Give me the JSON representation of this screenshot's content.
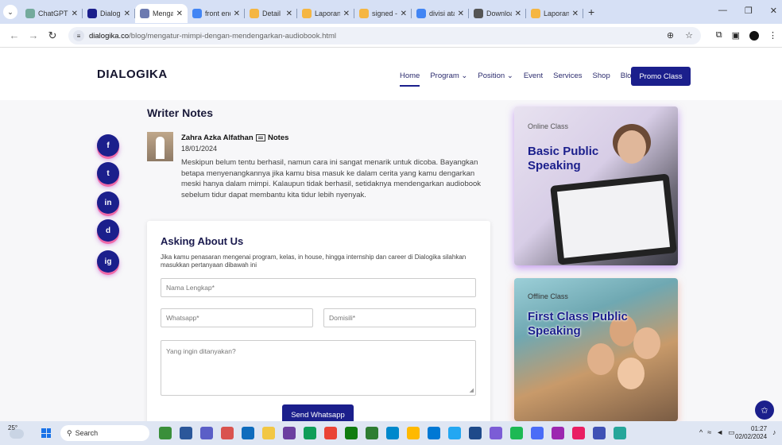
{
  "browser": {
    "tabs": [
      {
        "title": "ChatGPT",
        "color": "#74aa9c",
        "active": false
      },
      {
        "title": "Dialogika",
        "color": "#1b1f8c",
        "active": false
      },
      {
        "title": "Mengatur",
        "color": "#6c7ab0",
        "active": true
      },
      {
        "title": "front end",
        "color": "#4285f4",
        "active": false
      },
      {
        "title": "Detail",
        "color": "#f5b642",
        "active": false
      },
      {
        "title": "Laporan P",
        "color": "#f5b642",
        "active": false
      },
      {
        "title": "signed - R",
        "color": "#f5b642",
        "active": false
      },
      {
        "title": "divisi atau",
        "color": "#4285f4",
        "active": false
      },
      {
        "title": "Download",
        "color": "#555555",
        "active": false
      },
      {
        "title": "Laporan P",
        "color": "#f5b642",
        "active": false
      }
    ],
    "new_tab": "+",
    "url_host": "dialogika.co",
    "url_path": "/blog/mengatur-mimpi-dengan-mendengarkan-audiobook.html"
  },
  "site": {
    "logo": "DIALOGIKA",
    "nav": {
      "home": "Home",
      "program": "Program",
      "position": "Position",
      "event": "Event",
      "services": "Services",
      "shop": "Shop",
      "blog": "Blog"
    },
    "promo_button": "Promo Class"
  },
  "social": [
    "f",
    "t",
    "in",
    "d",
    "ig"
  ],
  "article": {
    "section_title": "Writer Notes",
    "author": "Zahra Azka Alfathan",
    "category": "Notes",
    "date": "18/01/2024",
    "body": "Meskipun belum tentu berhasil, namun cara ini sangat menarik untuk dicoba. Bayangkan betapa menyenangkannya jika kamu bisa masuk ke dalam cerita yang kamu dengarkan meski hanya dalam mimpi. Kalaupun tidak berhasil, setidaknya mendengarkan audiobook sebelum tidur dapat membantu kita tidur lebih nyenyak."
  },
  "form": {
    "title": "Asking About Us",
    "description": "Jika kamu penasaran mengenai program, kelas, in house, hingga internship dan career di Dialogika silahkan masukkan pertanyaan dibawah ini",
    "name_placeholder": "Nama Lengkap*",
    "whatsapp_placeholder": "Whatsapp*",
    "domicile_placeholder": "Domisili*",
    "question_placeholder": "Yang ingin ditanyakan?",
    "submit_label": "Send Whatsapp"
  },
  "cards": [
    {
      "kicker": "Online Class",
      "title": "Basic Public Speaking"
    },
    {
      "kicker": "Offline Class",
      "title": "First Class Public Speaking"
    }
  ],
  "taskbar": {
    "temperature": "25°",
    "search_label": "Search",
    "time": "01:27",
    "date": "02/02/2024"
  }
}
